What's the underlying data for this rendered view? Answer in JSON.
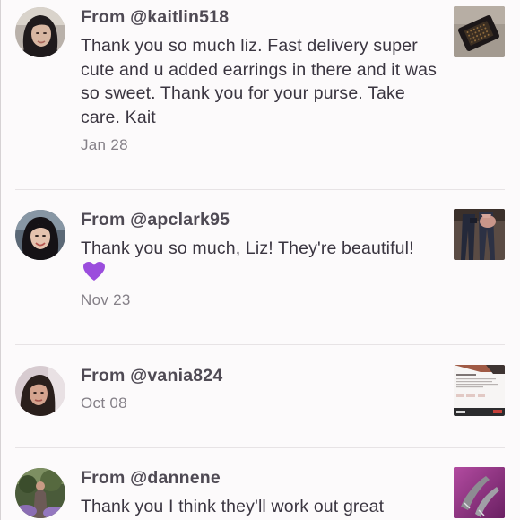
{
  "notes": [
    {
      "from_prefix": "From ",
      "handle": "@kaitlin518",
      "message": "Thank you so much liz. Fast delivery super cute and u added earrings in there and it was so sweet. Thank you for your purse. Take care. Kait",
      "date": "Jan 28",
      "thumb": "dark-purse-photo"
    },
    {
      "from_prefix": "From ",
      "handle": "@apclark95",
      "message": "Thank you so much, Liz! They're beautiful! ",
      "emoji": "purple-heart",
      "date": "Nov 23",
      "thumb": "jeans-outfit-photo"
    },
    {
      "from_prefix": "From ",
      "handle": "@vania824",
      "date": "Oct 08",
      "thumb": "listing-screenshot-photo"
    },
    {
      "from_prefix": "From ",
      "handle": "@dannene",
      "message": "Thank you I think they'll work out great",
      "thumb": "heels-photo"
    }
  ],
  "colors": {
    "background": "#fcfafb",
    "text_primary": "#3a3540",
    "text_secondary": "#858088",
    "heart": "#9b4ddd"
  }
}
